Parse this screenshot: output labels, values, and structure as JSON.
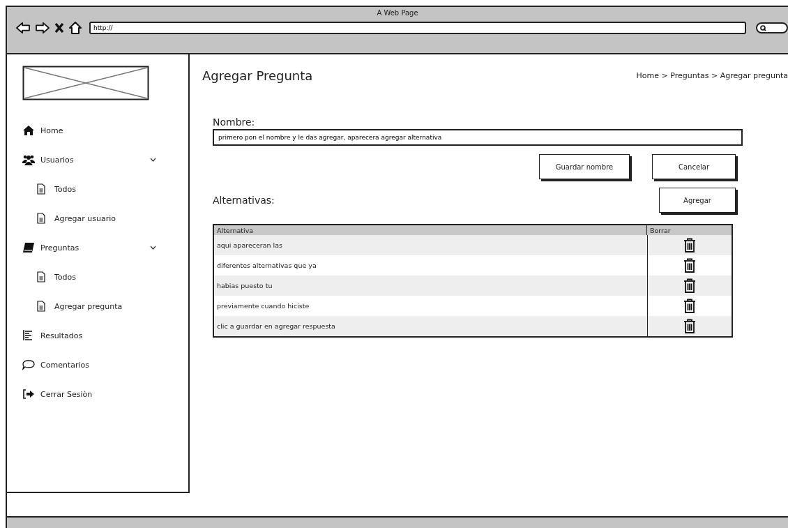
{
  "window": {
    "title": "A Web Page",
    "url": "http://"
  },
  "sidebar": {
    "items": [
      {
        "label": "Home"
      },
      {
        "label": "Usuarios",
        "expanded": true,
        "children": [
          {
            "label": "Todos"
          },
          {
            "label": "Agregar usuario"
          }
        ]
      },
      {
        "label": "Preguntas",
        "expanded": true,
        "children": [
          {
            "label": "Todos"
          },
          {
            "label": "Agregar pregunta"
          }
        ]
      },
      {
        "label": "Resultados"
      },
      {
        "label": "Comentarios"
      },
      {
        "label": "Cerrar Sesiòn"
      }
    ]
  },
  "page": {
    "title": "Agregar Pregunta",
    "breadcrumb": "Home > Preguntas > Agregar pregunta"
  },
  "name_field": {
    "label": "Nombre:",
    "value": "primero pon el nombre y le das agregar, aparecera agregar alternativa"
  },
  "name_buttons": [
    "Guardar nombre",
    "Cancelar"
  ],
  "alternatives": {
    "label": "Alternativas:",
    "add_button": "Agregar"
  },
  "table": {
    "columns": [
      "Alternativa",
      "Borrar"
    ],
    "rows": [
      {
        "text": "aqui apareceran las"
      },
      {
        "text": "diferentes alternativas que ya"
      },
      {
        "text": "habias puesto tu"
      },
      {
        "text": "previamente cuando hiciste"
      },
      {
        "text": "clic a guardar en agregar respuesta"
      }
    ]
  }
}
